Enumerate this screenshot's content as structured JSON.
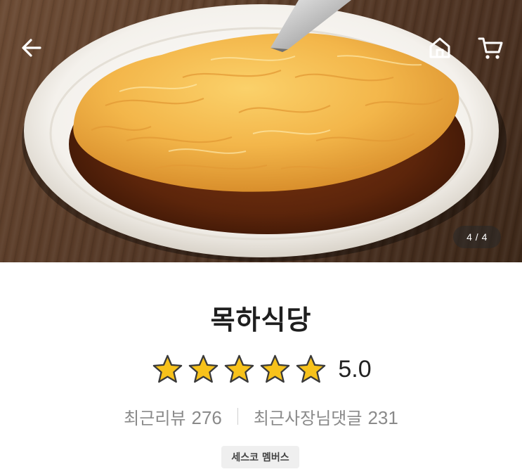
{
  "hero": {
    "image_counter": "4 / 4"
  },
  "nav": {
    "back_icon": "arrow-left-icon",
    "home_icon": "home-icon",
    "cart_icon": "cart-icon"
  },
  "store": {
    "name": "목하식당",
    "rating": {
      "stars_filled": 5,
      "stars_total": 5,
      "value": "5.0"
    },
    "reviews": {
      "recent_reviews_label": "최근리뷰",
      "recent_reviews_count": "276",
      "owner_replies_label": "최근사장님댓글",
      "owner_replies_count": "231"
    },
    "badge": "세스코 멤버스"
  },
  "colors": {
    "star": "#f7c21b",
    "star_outline": "#3a3a3a"
  }
}
